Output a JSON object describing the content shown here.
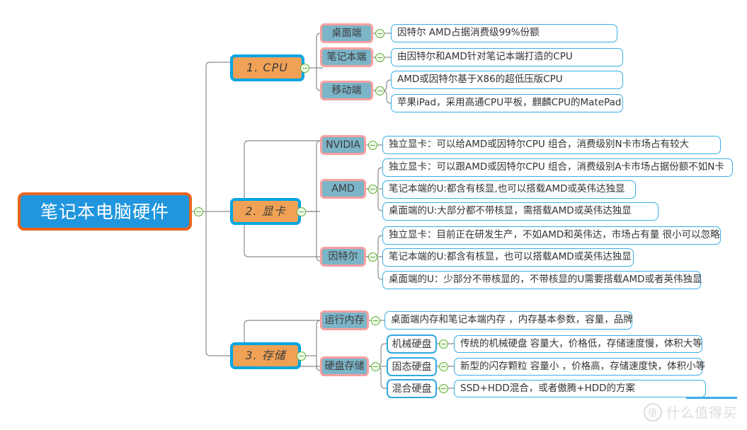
{
  "title": "笔记本电脑硬件",
  "colors": {
    "root_fill": "#2196de",
    "root_border": "#e8641c",
    "level1_fill": "#f0a155",
    "level1_border": "#00a5e3",
    "level2_fill": "#7cb4c8",
    "level2_border": "#f7a0a0",
    "leaf_fill": "#ffffff",
    "leaf_border": "#3aaee5",
    "connector": "#8c8c8c",
    "toggle": "#5bb030"
  },
  "root": {
    "label": "笔记本电脑硬件"
  },
  "branches": [
    {
      "label": "1. CPU",
      "children": [
        {
          "label": "桌面端",
          "leaves": [
            "因特尔 AMD占据消费级99%份额"
          ]
        },
        {
          "label": "笔记本端",
          "leaves": [
            "由因特尔和AMD针对笔记本端打造的CPU"
          ]
        },
        {
          "label": "移动端",
          "leaves": [
            "AMD或因特尔基于X86的超低压版CPU",
            "苹果iPad，采用高通CPU平板，麒麟CPU的MatePad"
          ]
        }
      ]
    },
    {
      "label": "2. 显卡",
      "children": [
        {
          "label": "NVIDIA",
          "leaves": [
            "独立显卡：可以给AMD或因特尔CPU 组合，消费级别N卡市场占有较大"
          ]
        },
        {
          "label": "AMD",
          "leaves": [
            "独立显卡：可以跟AMD或因特尔CPU 组合，消费级别A卡市场占据份额不如N卡",
            "笔记本端的U:都含有核显,也可以搭载AMD或英伟达独显",
            "桌面端的U:大部分都不带核显，需搭载AMD或英伟达独显"
          ]
        },
        {
          "label": "因特尔",
          "leaves": [
            "独立显卡：目前正在研发生产，不如AMD和英伟达，市场占有量 很小可以忽略",
            "笔记本端的U:都含有核显，也可以搭载AMD或英伟达独显",
            "桌面端的U：少部分不带核显的，不带核显的U需要搭载AMD或者英伟独显"
          ]
        }
      ]
    },
    {
      "label": "3. 存储",
      "children": [
        {
          "label": "运行内存",
          "leaves": [
            "桌面端内存和笔记本端内存 ，内存基本参数，容量，品牌"
          ]
        },
        {
          "label": "硬盘存储",
          "mids": [
            {
              "label": "机械硬盘",
              "leaf": "传统的机械硬盘 容量大，价格低，存储速度慢，体积大等"
            },
            {
              "label": "固态硬盘",
              "leaf": "新型的闪存颗粒 容量小 ，价格高，存储速度快，体积小等"
            },
            {
              "label": "混合硬盘",
              "leaf": "SSD+HDD混合，或者傲腾+HDD的方案"
            }
          ]
        }
      ]
    }
  ],
  "watermark": {
    "badge": "值",
    "text": "什么值得买"
  }
}
